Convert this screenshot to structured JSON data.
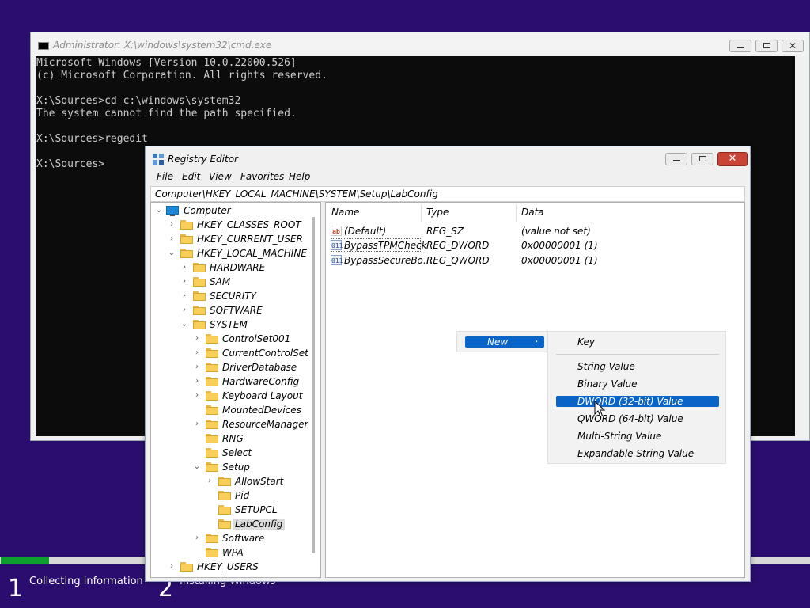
{
  "cmd": {
    "title": "Administrator: X:\\windows\\system32\\cmd.exe",
    "lines": [
      "Microsoft Windows [Version 10.0.22000.526]",
      "(c) Microsoft Corporation. All rights reserved.",
      "",
      "X:\\Sources>cd c:\\windows\\system32",
      "The system cannot find the path specified.",
      "",
      "X:\\Sources>regedit",
      "",
      "X:\\Sources>"
    ]
  },
  "setup": {
    "progress_fraction": 0.06,
    "steps": [
      {
        "number": "1",
        "label": "Collecting information"
      },
      {
        "number": "2",
        "label": "Installing Windows"
      }
    ]
  },
  "regedit": {
    "title": "Registry Editor",
    "menu": [
      "File",
      "Edit",
      "View",
      "Favorites",
      "Help"
    ],
    "address": "Computer\\HKEY_LOCAL_MACHINE\\SYSTEM\\Setup\\LabConfig",
    "tree": [
      {
        "label": "Computer",
        "level": 0,
        "expander": "open",
        "icon": "computer-icon"
      },
      {
        "label": "HKEY_CLASSES_ROOT",
        "level": 1,
        "expander": "closed"
      },
      {
        "label": "HKEY_CURRENT_USER",
        "level": 1,
        "expander": "closed"
      },
      {
        "label": "HKEY_LOCAL_MACHINE",
        "level": 1,
        "expander": "open"
      },
      {
        "label": "HARDWARE",
        "level": 2,
        "expander": "closed"
      },
      {
        "label": "SAM",
        "level": 2,
        "expander": "closed"
      },
      {
        "label": "SECURITY",
        "level": 2,
        "expander": "closed"
      },
      {
        "label": "SOFTWARE",
        "level": 2,
        "expander": "closed"
      },
      {
        "label": "SYSTEM",
        "level": 2,
        "expander": "open"
      },
      {
        "label": "ControlSet001",
        "level": 3,
        "expander": "closed"
      },
      {
        "label": "CurrentControlSet",
        "level": 3,
        "expander": "closed"
      },
      {
        "label": "DriverDatabase",
        "level": 3,
        "expander": "closed"
      },
      {
        "label": "HardwareConfig",
        "level": 3,
        "expander": "closed"
      },
      {
        "label": "Keyboard Layout",
        "level": 3,
        "expander": "closed"
      },
      {
        "label": "MountedDevices",
        "level": 3,
        "expander": "none"
      },
      {
        "label": "ResourceManager",
        "level": 3,
        "expander": "closed"
      },
      {
        "label": "RNG",
        "level": 3,
        "expander": "none"
      },
      {
        "label": "Select",
        "level": 3,
        "expander": "none"
      },
      {
        "label": "Setup",
        "level": 3,
        "expander": "open"
      },
      {
        "label": "AllowStart",
        "level": 4,
        "expander": "closed"
      },
      {
        "label": "Pid",
        "level": 4,
        "expander": "none"
      },
      {
        "label": "SETUPCL",
        "level": 4,
        "expander": "none"
      },
      {
        "label": "LabConfig",
        "level": 4,
        "expander": "none",
        "selected": true
      },
      {
        "label": "Software",
        "level": 3,
        "expander": "closed"
      },
      {
        "label": "WPA",
        "level": 3,
        "expander": "none"
      },
      {
        "label": "HKEY_USERS",
        "level": 1,
        "expander": "closed"
      }
    ],
    "columns": [
      "Name",
      "Type",
      "Data"
    ],
    "values": [
      {
        "name": "(Default)",
        "type": "REG_SZ",
        "data": "(value not set)",
        "icon": "string-value-icon"
      },
      {
        "name": "BypassTPMCheck",
        "type": "REG_DWORD",
        "data": "0x00000001 (1)",
        "icon": "binary-value-icon"
      },
      {
        "name": "BypassSecureBo...",
        "type": "REG_QWORD",
        "data": "0x00000001 (1)",
        "icon": "binary-value-icon"
      }
    ],
    "context_menu": {
      "new_label": "New"
    },
    "new_submenu": [
      "Key",
      "String Value",
      "Binary Value",
      "DWORD (32-bit) Value",
      "QWORD (64-bit) Value",
      "Multi-String Value",
      "Expandable String Value"
    ],
    "highlighted_submenu_item": "DWORD (32-bit) Value"
  },
  "colors": {
    "desktop_bg": "#2a0d6e",
    "console_bg": "#0c0c0c",
    "console_text": "#cccccc",
    "highlight": "#0a64c8",
    "progress": "#0ea02e",
    "close_button": "#c94434"
  }
}
